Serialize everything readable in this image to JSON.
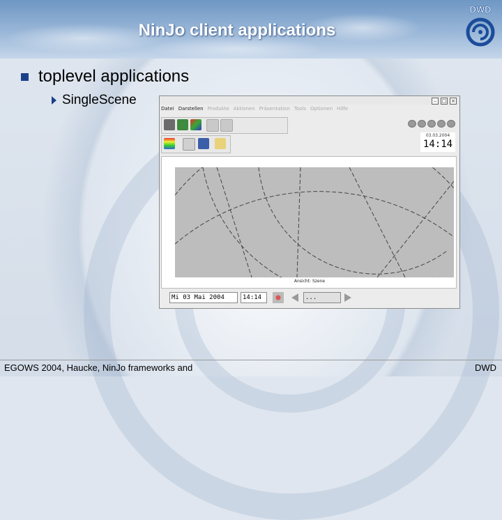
{
  "slide": {
    "title": "NinJo client applications",
    "bullet_1": "toplevel applications",
    "bullet_2": "SingleScene",
    "footer_left": "EGOWS 2004, Haucke, NinJo frameworks and",
    "footer_right": "DWD",
    "logo_text": "DWD"
  },
  "app": {
    "menu": {
      "items": [
        {
          "label": "Datei",
          "enabled": true
        },
        {
          "label": "Darstellen",
          "enabled": true
        },
        {
          "label": "Produkte",
          "enabled": false
        },
        {
          "label": "Aktionen",
          "enabled": false
        },
        {
          "label": "Präsentation",
          "enabled": false
        },
        {
          "label": "Tools",
          "enabled": false
        },
        {
          "label": "Optionen",
          "enabled": false
        },
        {
          "label": "Hilfe",
          "enabled": false
        }
      ]
    },
    "clock": {
      "date": "03.03.2004",
      "time": "14:14"
    },
    "map_caption": "Ansicht: Szene",
    "timebar": {
      "date_field": "Mi 03 Mai 2004",
      "time_field": "14:14",
      "step_field": "..."
    },
    "colors": {
      "accent": "#1a3f8a",
      "map_bg": "#bdbdbd"
    }
  }
}
